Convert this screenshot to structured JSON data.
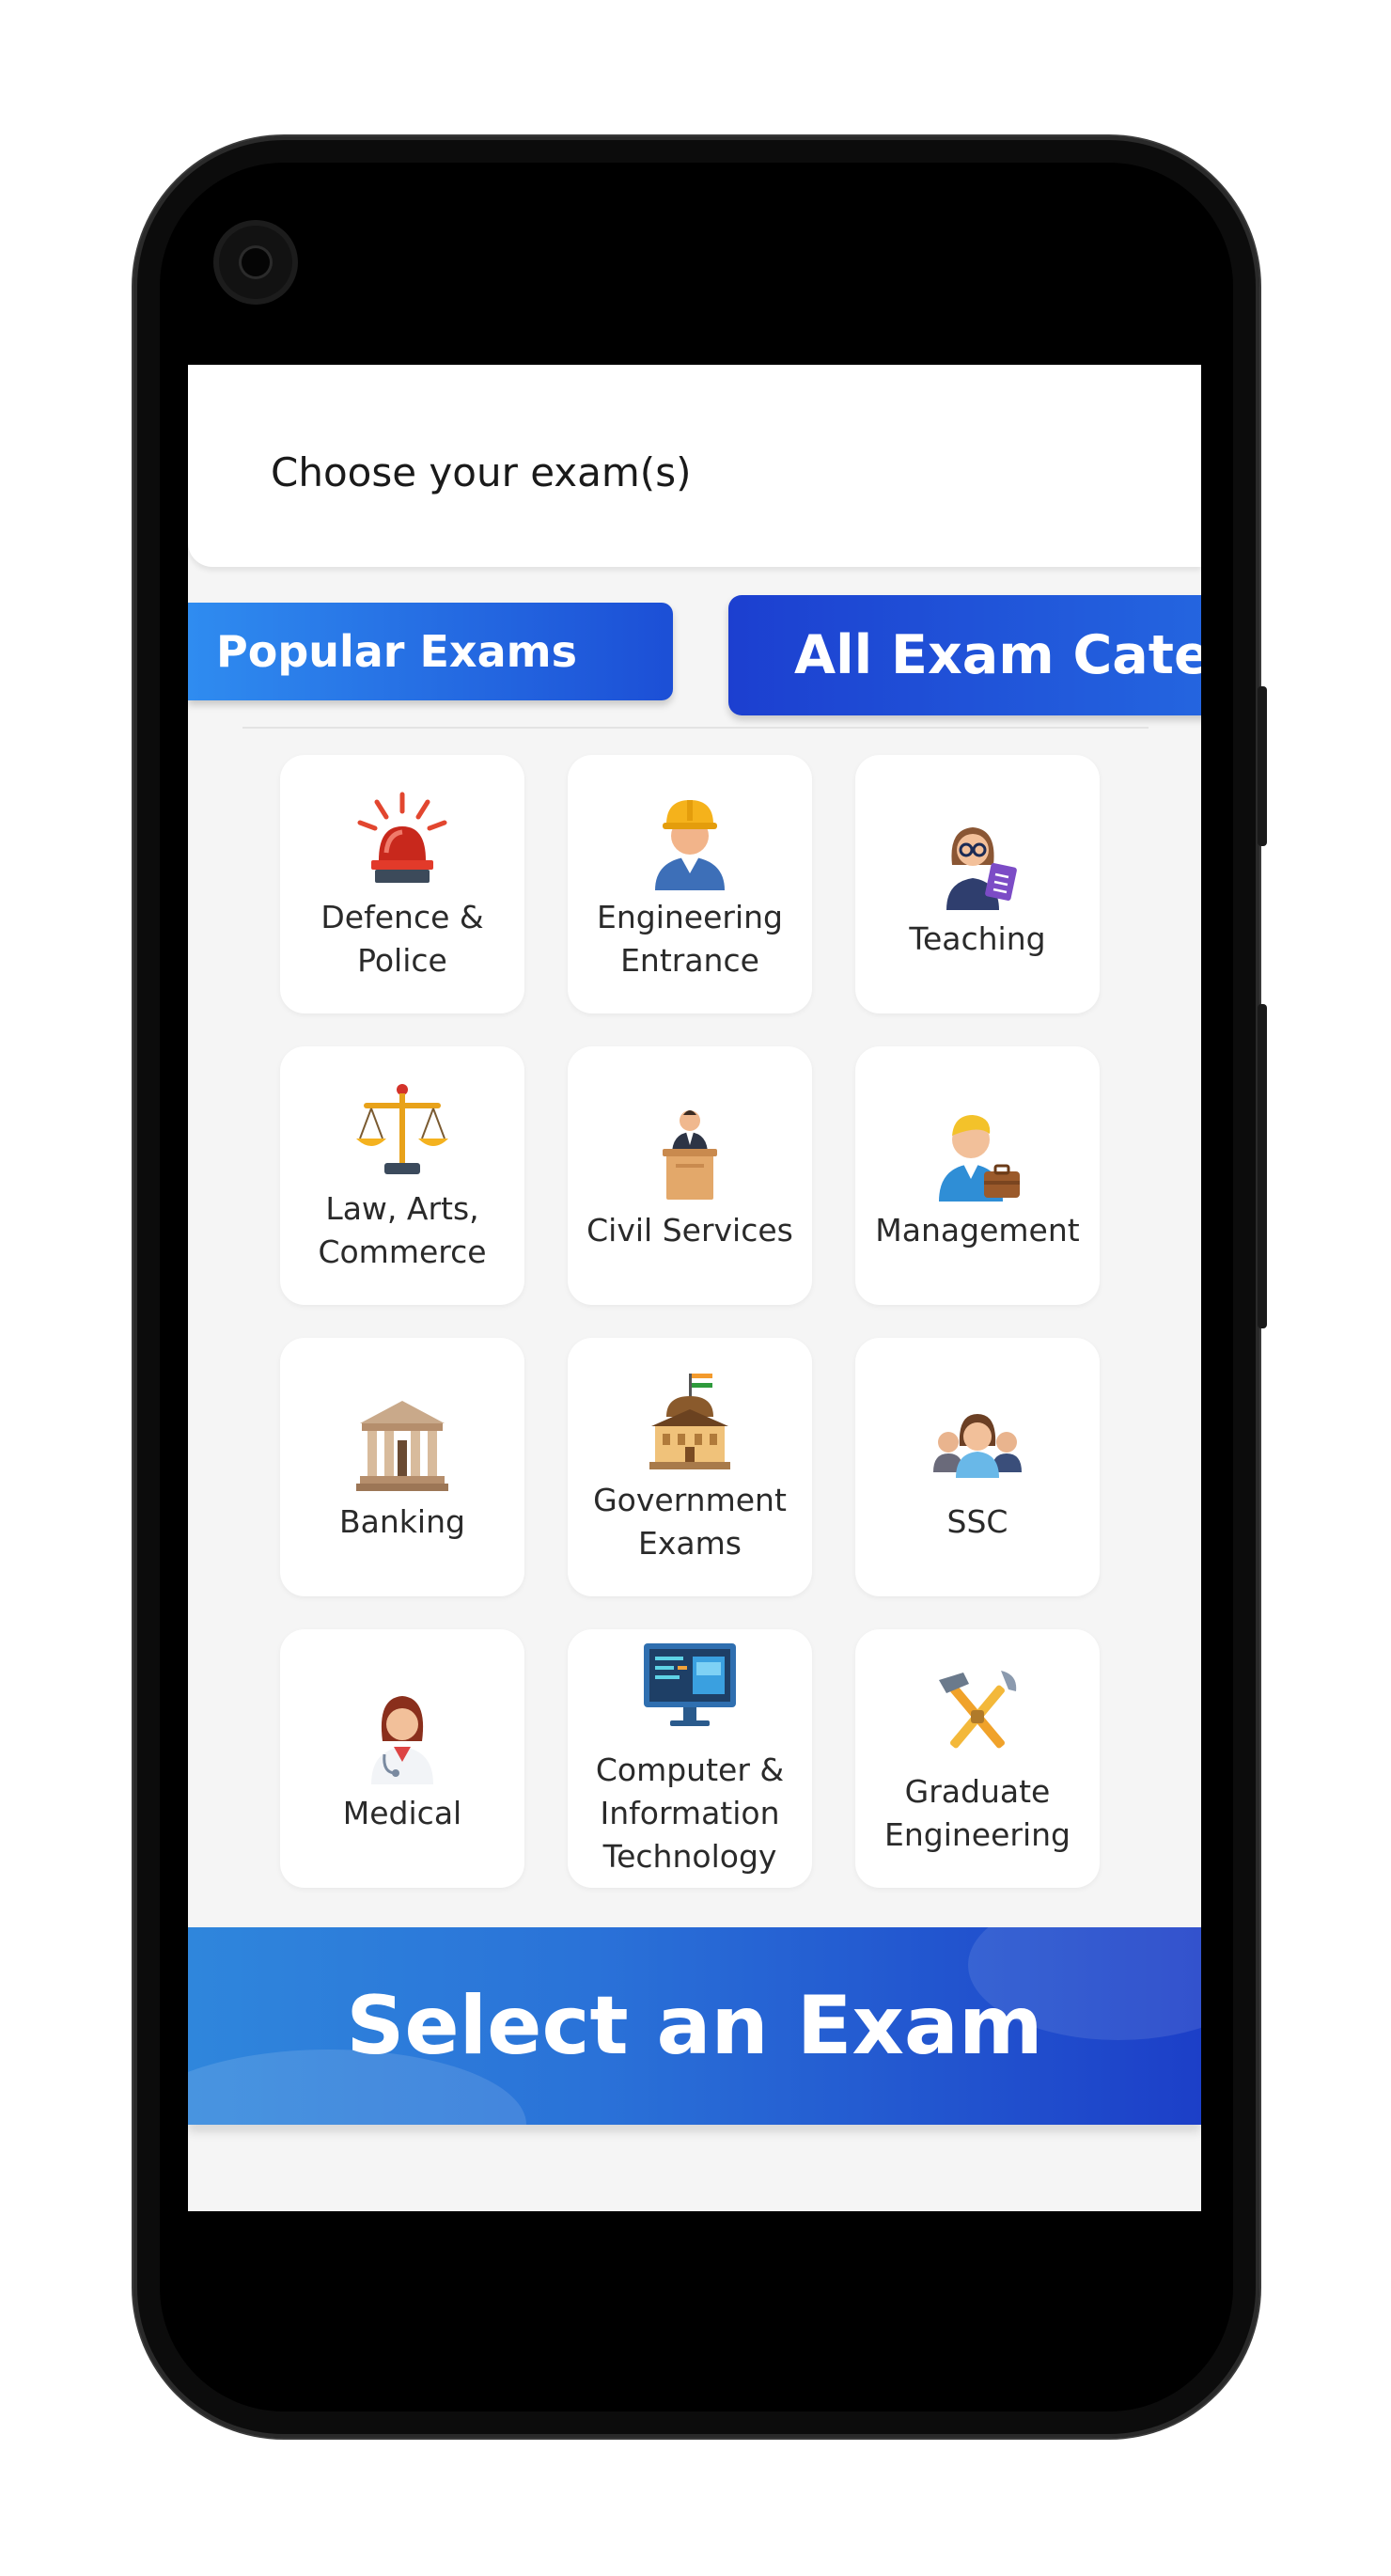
{
  "header": {
    "title": "Choose your exam(s)"
  },
  "tabs": {
    "popular": "Popular Exams",
    "all": "All Exam Categ"
  },
  "categories": [
    {
      "label": "Defence & Police",
      "icon": "siren-icon"
    },
    {
      "label": "Engineering Entrance",
      "icon": "engineer-icon"
    },
    {
      "label": "Teaching",
      "icon": "teacher-icon"
    },
    {
      "label": "Law, Arts, Commerce",
      "icon": "scales-icon"
    },
    {
      "label": "Civil Services",
      "icon": "podium-speaker-icon"
    },
    {
      "label": "Management",
      "icon": "manager-icon"
    },
    {
      "label": "Banking",
      "icon": "bank-icon"
    },
    {
      "label": "Government Exams",
      "icon": "government-building-icon"
    },
    {
      "label": "SSC",
      "icon": "group-people-icon"
    },
    {
      "label": "Medical",
      "icon": "doctor-icon"
    },
    {
      "label": "Computer & Information Technology",
      "icon": "computer-monitor-icon"
    },
    {
      "label": "Graduate Engineering",
      "icon": "tools-icon"
    }
  ],
  "banner": {
    "text": "Select an Exam"
  },
  "colors": {
    "accent_light": "#2f8cf0",
    "accent_dark": "#1c3fd0",
    "background": "#f5f5f5"
  }
}
